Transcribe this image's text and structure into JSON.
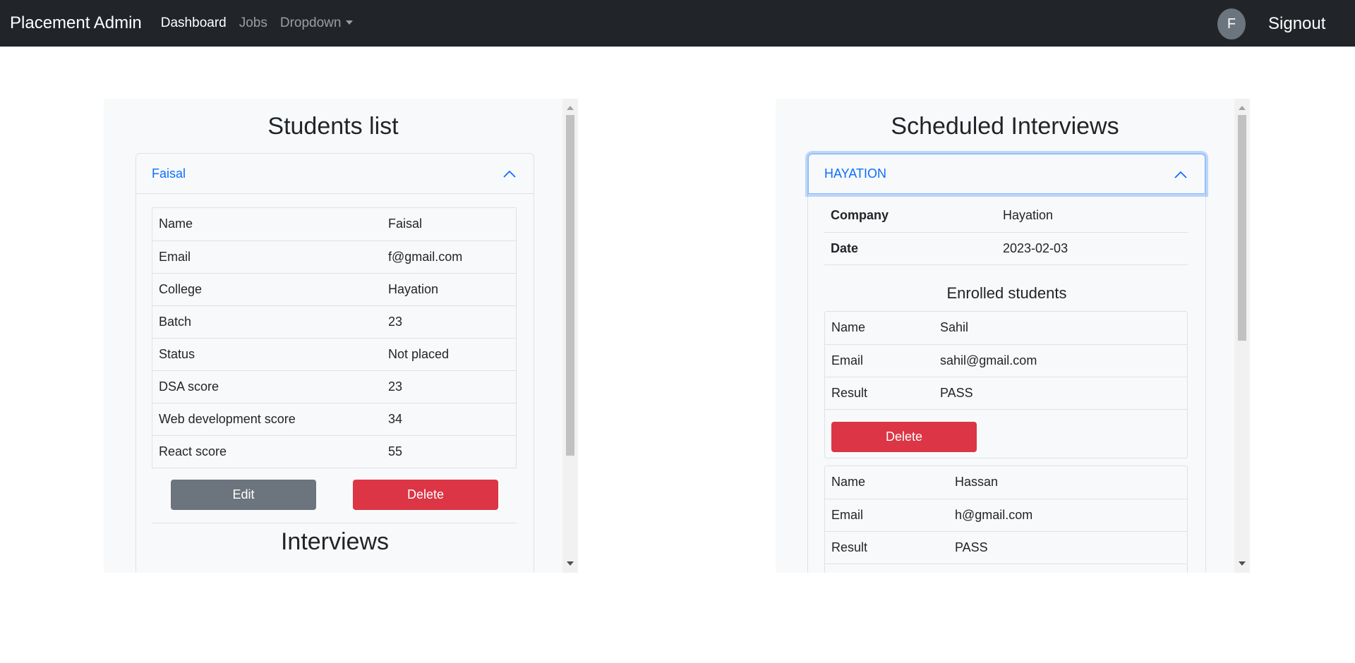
{
  "navbar": {
    "brand": "Placement Admin",
    "links": [
      "Dashboard",
      "Jobs",
      "Dropdown"
    ],
    "avatar_initial": "F",
    "signout": "Signout"
  },
  "students": {
    "title": "Students list",
    "accordion_label": "Faisal",
    "rows": [
      {
        "label": "Name",
        "value": "Faisal"
      },
      {
        "label": "Email",
        "value": "f@gmail.com"
      },
      {
        "label": "College",
        "value": "Hayation"
      },
      {
        "label": "Batch",
        "value": "23"
      },
      {
        "label": "Status",
        "value": "Not placed"
      },
      {
        "label": "DSA score",
        "value": "23"
      },
      {
        "label": "Web development score",
        "value": "34"
      },
      {
        "label": "React score",
        "value": "55"
      }
    ],
    "edit_label": "Edit",
    "delete_label": "Delete",
    "interviews_title": "Interviews"
  },
  "interviews": {
    "title": "Scheduled Interviews",
    "accordion_label": "HAYATION",
    "company_label": "Company",
    "company_value": "Hayation",
    "date_label": "Date",
    "date_value": "2023-02-03",
    "enrolled_title": "Enrolled students",
    "students": [
      {
        "name_label": "Name",
        "name": "Sahil",
        "email_label": "Email",
        "email": "sahil@gmail.com",
        "result_label": "Result",
        "result": "PASS",
        "delete_label": "Delete"
      },
      {
        "name_label": "Name",
        "name": "Hassan",
        "email_label": "Email",
        "email": "h@gmail.com",
        "result_label": "Result",
        "result": "PASS"
      }
    ]
  },
  "colors": {
    "navbar": "#212529",
    "link": "#0d6efd",
    "danger": "#dc3545",
    "secondary": "#6c757d"
  }
}
